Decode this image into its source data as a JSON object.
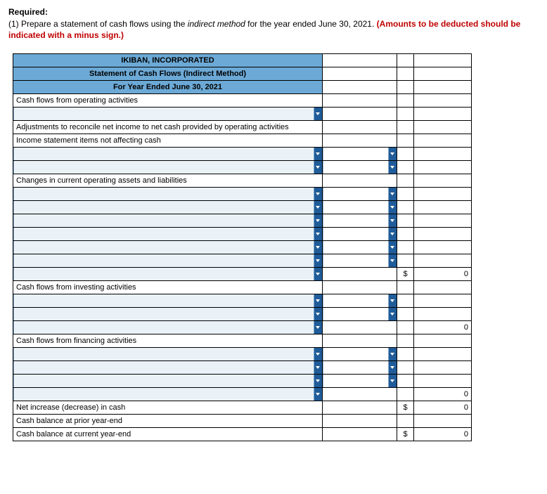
{
  "required_label": "Required:",
  "instruction_prefix": "(1) ",
  "instruction_a": "Prepare a statement of cash flows using the ",
  "instruction_italic": "indirect method",
  "instruction_b": " for the year ended June 30, 2021. ",
  "instruction_red": "(Amounts to be deducted should be indicated with a minus sign.)",
  "header1": "IKIBAN, INCORPORATED",
  "header2": "Statement of Cash Flows (Indirect Method)",
  "header3": "For Year Ended June 30, 2021",
  "labels": {
    "cf_operating": "Cash flows from operating activities",
    "adjustments": "Adjustments to reconcile net income to net cash provided by operating activities",
    "income_items": "Income statement items not affecting cash",
    "changes": "Changes in current operating assets and liabilities",
    "cf_investing": "Cash flows from investing activities",
    "cf_financing": "Cash flows from financing activities",
    "net_increase": "Net increase (decrease) in cash",
    "cash_prior": "Cash balance at prior year-end",
    "cash_current": "Cash balance at current year-end"
  },
  "sym": "$",
  "zero": "0"
}
